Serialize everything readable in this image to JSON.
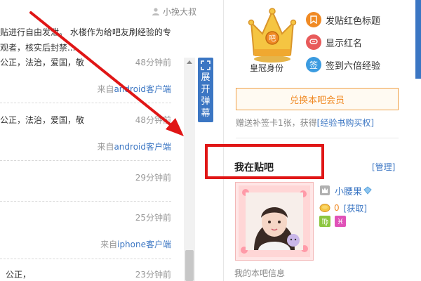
{
  "feed": {
    "author": "小挽大叔",
    "intro_line1": "贴进行自由发泄。 水楼作为给吧友刷经验的专",
    "intro_line2": "观者，核实后封禁...",
    "rows": [
      {
        "text": "公正，法治，爱国，敬",
        "time": "48分钟前",
        "source_prefix": "来自",
        "source_client": "android客户端"
      },
      {
        "text": "公正，法治，爱国，敬",
        "time": "48分钟前",
        "source_prefix": "来自",
        "source_client": "android客户端"
      },
      {
        "text": "",
        "time": "29分钟前",
        "source_prefix": "",
        "source_client": ""
      },
      {
        "text": "",
        "time": "25分钟前",
        "source_prefix": "来自",
        "source_client": "iphone客户端"
      },
      {
        "text": "公正，",
        "time": "23分钟前",
        "source_prefix": "",
        "source_client": ""
      }
    ],
    "expand_label": "展开弹幕"
  },
  "sidebar": {
    "crown_label": "皇冠身份",
    "perks": [
      {
        "label": "发贴红色标题",
        "icon": "bookmark-icon",
        "color": "#f08a24"
      },
      {
        "label": "显示红名",
        "icon": "chat-bubble-icon",
        "color": "#e85a5a"
      },
      {
        "label": "签到六倍经验",
        "icon": "sign-icon",
        "color": "#3b9be0"
      }
    ],
    "redeem_button": "兑换本吧会员",
    "gift_text": "赠送补签卡1张，获得",
    "gift_link": "[经验书购买权]",
    "my_tieba_title": "我在贴吧",
    "manage_link": "[管理]",
    "username": "小腰果",
    "coin_count": "0",
    "get_link": "[获取]",
    "my_info": "我的本吧信息"
  },
  "colors": {
    "accent_blue": "#3b76c3",
    "orange": "#f08a24",
    "annotation_red": "#e01616"
  }
}
